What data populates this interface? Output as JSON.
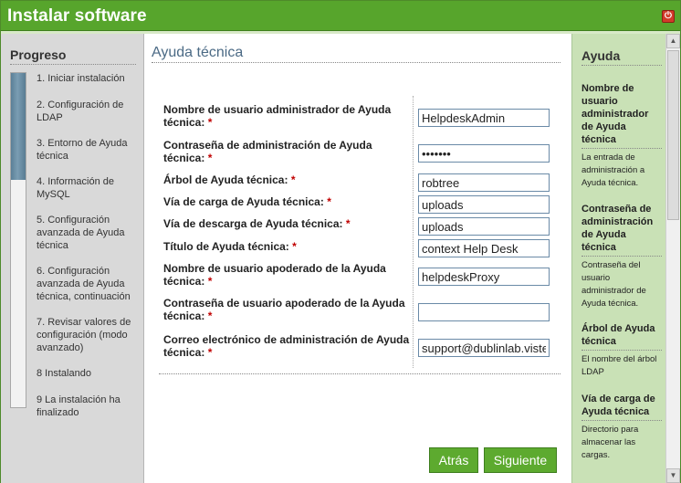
{
  "window": {
    "title": "Instalar software",
    "power_icon": "power-icon"
  },
  "sidebar": {
    "heading": "Progreso",
    "progress_fraction": 0.32,
    "steps": [
      "1. Iniciar instalación",
      "2. Configuración de LDAP",
      "3. Entorno de Ayuda técnica",
      "4. Información de MySQL",
      "5. Configuración avanzada de Ayuda técnica",
      "6. Configuración avanzada de Ayuda técnica, continuación",
      "7. Revisar valores de configuración (modo avanzado)",
      "8 Instalando",
      "9 La instalación ha finalizado"
    ]
  },
  "main": {
    "title": "Ayuda técnica",
    "required_marker": "*",
    "fields": [
      {
        "label": "Nombre de usuario administrador de Ayuda técnica:",
        "value": "HelpdeskAdmin"
      },
      {
        "label": "Contraseña de administración de Ayuda técnica:",
        "value": "*******"
      },
      {
        "label": "Árbol de Ayuda técnica:",
        "value": "robtree"
      },
      {
        "label": "Vía de carga de Ayuda técnica:",
        "value": "uploads"
      },
      {
        "label": "Vía de descarga de Ayuda técnica:",
        "value": "uploads"
      },
      {
        "label": "Título de Ayuda técnica:",
        "value": "context Help Desk"
      },
      {
        "label": "Nombre de usuario apoderado de la Ayuda técnica:",
        "value": "helpdeskProxy"
      },
      {
        "label": "Contraseña de usuario apoderado de la Ayuda técnica:",
        "value": ""
      },
      {
        "label": "Correo electrónico de administración de Ayuda técnica:",
        "value": "support@dublinlab.viste"
      }
    ],
    "back_button": "Atrás",
    "next_button": "Siguiente"
  },
  "help": {
    "heading": "Ayuda",
    "entries": [
      {
        "title": "Nombre de usuario administrador de Ayuda técnica",
        "text": "La entrada de administración a Ayuda técnica."
      },
      {
        "title": "Contraseña de administración de Ayuda técnica",
        "text": "Contraseña del usuario administrador de Ayuda técnica."
      },
      {
        "title": "Árbol de Ayuda técnica",
        "text": "El nombre del árbol LDAP"
      },
      {
        "title": "Vía de carga de Ayuda técnica",
        "text": "Directorio para almacenar las cargas."
      }
    ]
  },
  "colors": {
    "accent": "#57a52c",
    "help_panel": "#c9e1b6",
    "sidebar": "#d9d9d9",
    "title_blue": "#4b6a85"
  }
}
